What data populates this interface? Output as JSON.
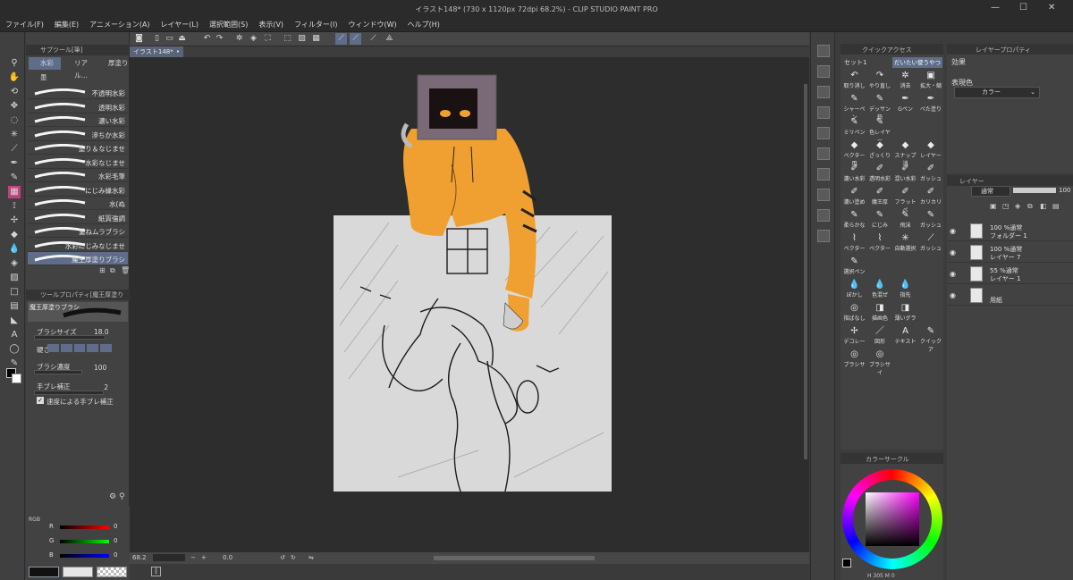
{
  "window": {
    "title": "イラスト148* (730 x 1120px 72dpi 68.2%) - CLIP STUDIO PAINT PRO"
  },
  "menu": [
    "ファイル(F)",
    "編集(E)",
    "アニメーション(A)",
    "レイヤー(L)",
    "選択範囲(S)",
    "表示(V)",
    "フィルター(I)",
    "ウィンドウ(W)",
    "ヘルプ(H)"
  ],
  "subtool": {
    "panel_title": "サブツール[筆]",
    "tabs": [
      "水彩",
      "リアル…",
      "厚塗り"
    ],
    "group": "墨",
    "brushes": [
      "不透明水彩",
      "透明水彩",
      "濃い水彩",
      "滲ちか水彩",
      "塗り＆なじませ",
      "水彩なじませ",
      "水彩毛筆",
      "にじみ縁水彩",
      "水(ぬ",
      "紙質強調",
      "重ねムラブラシ",
      "水彩にじみなじませ",
      "魔王厚塗りブラシ"
    ],
    "selected_index": 12
  },
  "tool_property": {
    "panel_title": "ツールプロパティ[魔王厚塗りブラシ]",
    "brush_name": "魔王厚塗りブラシ",
    "brush_size_label": "ブラシサイズ",
    "brush_size_value": "18.0",
    "hardness_label": "硬さ",
    "density_label": "ブラシ濃度",
    "density_value": "100",
    "stabilization_label": "手ブレ補正",
    "stabilization_value": "2",
    "speed_stabilization_label": "速度による手ブレ補正",
    "speed_stabilization_checked": true
  },
  "color_slider": {
    "mode": "RGB",
    "side_tabs": [
      "RGB",
      "HSV",
      "CMY"
    ],
    "r": "0",
    "g": "0",
    "b": "0",
    "r_label": "R",
    "g_label": "G",
    "b_label": "B"
  },
  "document": {
    "tab_label": "イラスト148*",
    "zoom": "68.2",
    "angle": "0.0"
  },
  "quick_access": {
    "panel_title": "クイックアクセス",
    "set_name": "セット1",
    "set_tab": "だいたい使うやつ",
    "items": [
      {
        "label": "取り消し",
        "icon": "↶"
      },
      {
        "label": "やり直し",
        "icon": "↷"
      },
      {
        "label": "消去",
        "icon": "✲"
      },
      {
        "label": "拡大・縮",
        "icon": "▣"
      },
      {
        "label": "シャーペン",
        "icon": "✎"
      },
      {
        "label": "デッサン鉛",
        "icon": "✎"
      },
      {
        "label": "Gペン",
        "icon": "✒"
      },
      {
        "label": "べた塗り",
        "icon": "✒"
      },
      {
        "label": "ミリペン",
        "icon": "✎"
      },
      {
        "label": "色レイヤー",
        "icon": "✎"
      },
      {
        "label": "",
        "icon": ""
      },
      {
        "label": "",
        "icon": ""
      },
      {
        "label": "ベクター用",
        "icon": "◆"
      },
      {
        "label": "ざっくり",
        "icon": "◆"
      },
      {
        "label": "スナップ消",
        "icon": "◆"
      },
      {
        "label": "レイヤー",
        "icon": "◆"
      },
      {
        "label": "濃い水彩",
        "icon": "✐"
      },
      {
        "label": "透明水彩",
        "icon": "✐"
      },
      {
        "label": "混い水彩",
        "icon": "✐"
      },
      {
        "label": "ガッシュ",
        "icon": "✐"
      },
      {
        "label": "濃い塗め",
        "icon": "✐"
      },
      {
        "label": "魔王厚",
        "icon": "✐"
      },
      {
        "label": "フラットペ",
        "icon": "✐"
      },
      {
        "label": "カリカリ",
        "icon": "✐"
      },
      {
        "label": "柔らかな",
        "icon": "✎"
      },
      {
        "label": "にじみ",
        "icon": "✎"
      },
      {
        "label": "飛沫",
        "icon": "✎"
      },
      {
        "label": "ガッシュ",
        "icon": "✎"
      },
      {
        "label": "ベクター",
        "icon": "⌇"
      },
      {
        "label": "ベクター",
        "icon": "⌇"
      },
      {
        "label": "自動選択",
        "icon": "✳"
      },
      {
        "label": "ガッシュ",
        "icon": "⟋"
      },
      {
        "label": "選択ペン",
        "icon": "✎"
      },
      {
        "label": "",
        "icon": ""
      },
      {
        "label": "",
        "icon": ""
      },
      {
        "label": "",
        "icon": ""
      },
      {
        "label": "ぼかし",
        "icon": "💧"
      },
      {
        "label": "色混ぜ",
        "icon": "💧"
      },
      {
        "label": "指先",
        "icon": "💧"
      },
      {
        "label": "",
        "icon": ""
      },
      {
        "label": "指ばなし",
        "icon": "◎"
      },
      {
        "label": "描画色",
        "icon": "◨"
      },
      {
        "label": "薄いグラ",
        "icon": "◨"
      },
      {
        "label": "",
        "icon": ""
      },
      {
        "label": "デコレー",
        "icon": "✢"
      },
      {
        "label": "図形",
        "icon": "／"
      },
      {
        "label": "テキスト",
        "icon": "A"
      },
      {
        "label": "クイックア",
        "icon": "✎"
      },
      {
        "label": "ブラシサ",
        "icon": "◎"
      },
      {
        "label": "ブラシサイ",
        "icon": "◎"
      },
      {
        "label": "",
        "icon": ""
      },
      {
        "label": "",
        "icon": ""
      }
    ]
  },
  "layer_property": {
    "panel_title": "レイヤープロパティ",
    "effect_label": "効果",
    "expression_label": "表現色",
    "expression_value": "カラー"
  },
  "layers": {
    "panel_title": "レイヤー",
    "blend_mode": "通常",
    "opacity": "100",
    "rows": [
      {
        "line1": "100 %通常",
        "line2": "フォルダー 1",
        "type": "folder"
      },
      {
        "line1": "100 %通常",
        "line2": "レイヤー 7",
        "type": "layer"
      },
      {
        "line1": "55 %通常",
        "line2": "レイヤー 1",
        "type": "layer"
      },
      {
        "line1": "",
        "line2": "用紙",
        "type": "paper"
      }
    ]
  },
  "color_circle": {
    "panel_title": "カラーサークル",
    "readout": "H 305 M 0"
  },
  "colors": {
    "accent": "#5f6d8a",
    "hoodie": "#f0a030",
    "paper": "#d9d9d9"
  }
}
